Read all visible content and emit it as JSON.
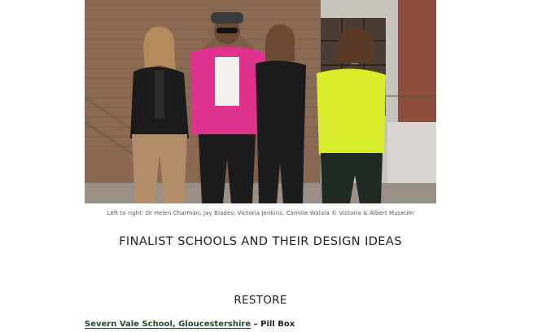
{
  "photo": {
    "alt": "Four finalists judges posing together in front of a brick wall",
    "colors": {
      "brick": "#8a6a52",
      "pink_jacket": "#e0338f",
      "yellow_sweater": "#d8ec2c",
      "black": "#1c1b1c",
      "tan": "#b38d6a"
    }
  },
  "caption": "Left to right: Dr Helen Charman,  Jay Blades, Victoria Jenkins, Camille Walala © Victoria & Albert Museum",
  "section_heading": "FINALIST SCHOOLS AND THEIR DESIGN IDEAS",
  "category_heading": "RESTORE",
  "entries": [
    {
      "school_link": "Severn Vale School, Gloucestershire",
      "separator": " – ",
      "project": "Pill Box"
    }
  ],
  "link_color": "#1f4a2a"
}
